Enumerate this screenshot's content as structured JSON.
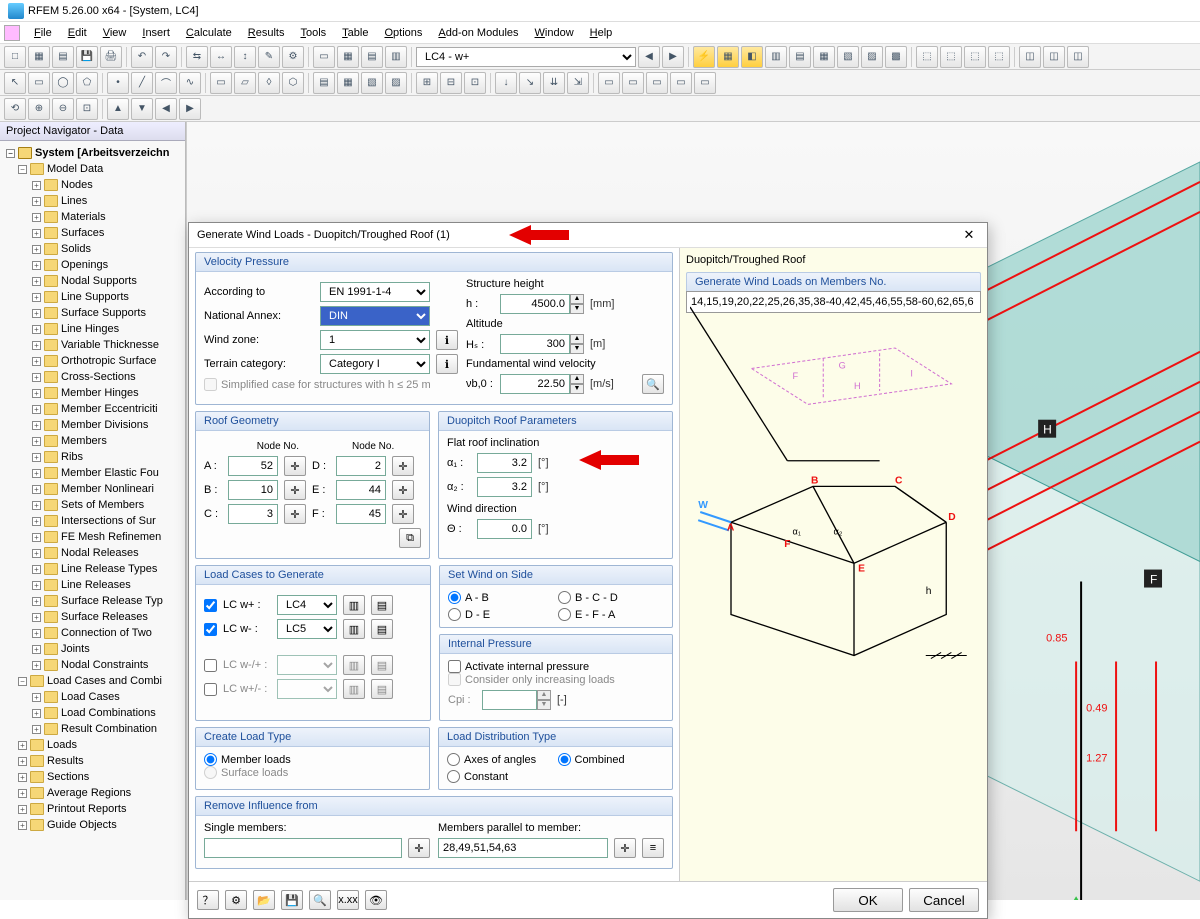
{
  "app": {
    "title": "RFEM 5.26.00 x64 - [System, LC4]"
  },
  "menu": [
    "File",
    "Edit",
    "View",
    "Insert",
    "Calculate",
    "Results",
    "Tools",
    "Table",
    "Options",
    "Add-on Modules",
    "Window",
    "Help"
  ],
  "toolbar": {
    "lc_selection": "LC4 - w+"
  },
  "navigator": {
    "title": "Project Navigator - Data",
    "root": "System [Arbeitsverzeichn",
    "model_data": "Model Data",
    "items_model": [
      "Nodes",
      "Lines",
      "Materials",
      "Surfaces",
      "Solids",
      "Openings",
      "Nodal Supports",
      "Line Supports",
      "Surface Supports",
      "Line Hinges",
      "Variable Thicknesse",
      "Orthotropic Surface",
      "Cross-Sections",
      "Member Hinges",
      "Member Eccentriciti",
      "Member Divisions",
      "Members",
      "Ribs",
      "Member Elastic Fou",
      "Member Nonlineari",
      "Sets of Members",
      "Intersections of Sur",
      "FE Mesh Refinemen",
      "Nodal Releases",
      "Line Release Types",
      "Line Releases",
      "Surface Release Typ",
      "Surface Releases",
      "Connection of Two",
      "Joints",
      "Nodal Constraints"
    ],
    "lcc": "Load Cases and Combi",
    "items_lcc": [
      "Load Cases",
      "Load Combinations",
      "Result Combination"
    ],
    "rest": [
      "Loads",
      "Results",
      "Sections",
      "Average Regions",
      "Printout Reports",
      "Guide Objects"
    ]
  },
  "dialog": {
    "title": "Generate Wind Loads  -  Duopitch/Troughed Roof   (1)",
    "velocity_pressure": {
      "label": "Velocity Pressure",
      "according_to_label": "According to",
      "according_to": "EN 1991-1-4",
      "annex_label": "National Annex:",
      "annex": "DIN",
      "wind_zone_label": "Wind zone:",
      "wind_zone": "1",
      "terrain_label": "Terrain category:",
      "terrain": "Category I",
      "simplified": "Simplified case for structures with h ≤ 25 m",
      "height_label": "Structure height",
      "h_label": "h :",
      "h_value": "4500.0",
      "h_unit": "[mm]",
      "altitude_label": "Altitude",
      "hs_label": "Hₛ :",
      "hs_value": "300",
      "hs_unit": "[m]",
      "fund_label": "Fundamental wind velocity",
      "vb0_label": "νb,0 :",
      "vb0_value": "22.50",
      "vb0_unit": "[m/s]"
    },
    "roof_geometry": {
      "label": "Roof Geometry",
      "node_no": "Node No.",
      "A": "A :",
      "A_val": "52",
      "B": "B :",
      "B_val": "10",
      "C": "C :",
      "C_val": "3",
      "D": "D :",
      "D_val": "2",
      "E": "E :",
      "E_val": "44",
      "F": "F :",
      "F_val": "45"
    },
    "duopitch": {
      "label": "Duopitch Roof Parameters",
      "flat_label": "Flat roof inclination",
      "a1_label": "α₁ :",
      "a1_val": "3.2",
      "deg": "[°]",
      "a2_label": "α₂ :",
      "a2_val": "3.2",
      "wind_dir_label": "Wind direction",
      "theta_label": "Θ :",
      "theta_val": "0.0"
    },
    "load_cases": {
      "label": "Load Cases to Generate",
      "wplus": "LC w+ :",
      "wplus_val": "LC4",
      "wminus": "LC w- :",
      "wminus_val": "LC5",
      "wminusplus": "LC w-/+ :",
      "wplusminus": "LC w+/- :"
    },
    "set_wind": {
      "label": "Set Wind on Side",
      "ab": "A - B",
      "bcd": "B - C - D",
      "de": "D - E",
      "efa": "E - F - A"
    },
    "internal_pressure": {
      "label": "Internal Pressure",
      "activate": "Activate internal pressure",
      "consider": "Consider only increasing loads",
      "cpi_label": "Cpi :",
      "cpi_unit": "[-]"
    },
    "create_load_type": {
      "label": "Create Load Type",
      "member": "Member loads",
      "surface": "Surface loads"
    },
    "distribution": {
      "label": "Load Distribution Type",
      "axes": "Axes of angles",
      "combined": "Combined",
      "constant": "Constant"
    },
    "remove_influence": {
      "label": "Remove Influence from",
      "single": "Single members:",
      "parallel": "Members parallel to member:",
      "parallel_val": "28,49,51,54,63"
    },
    "generate": {
      "label": "Generate Wind Loads on Members No.",
      "value": "14,15,19,20,22,25,26,35,38-40,42,45,46,55,58-60,62,65,6"
    },
    "diagram_title": "Duopitch/Troughed Roof",
    "ok": "OK",
    "cancel": "Cancel"
  },
  "viewport": {
    "labels": [
      "H",
      "F"
    ],
    "dims": [
      "0.85",
      "0.49",
      "1.27"
    ]
  }
}
